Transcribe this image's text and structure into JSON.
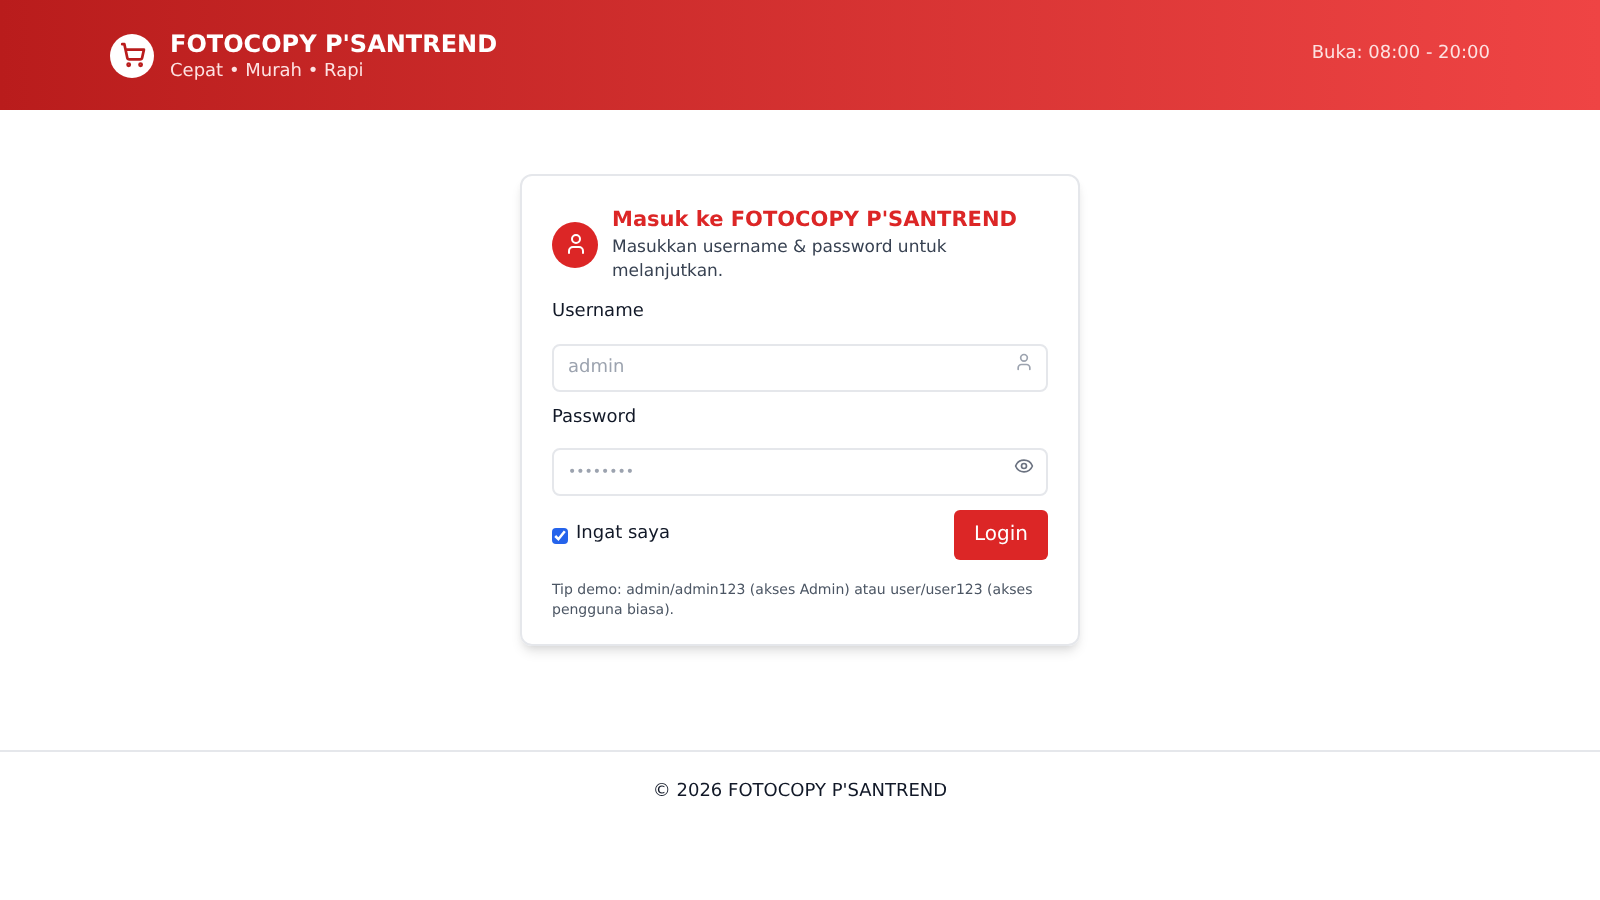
{
  "header": {
    "title": "FOTOCOPY P'SANTREND",
    "tagline": "Cepat • Murah • Rapi",
    "hours": "Buka: 08:00 - 20:00"
  },
  "login": {
    "title": "Masuk ke FOTOCOPY P'SANTREND",
    "subtitle": "Masukkan username & password untuk melanjutkan.",
    "username": {
      "label": "Username",
      "placeholder": "admin"
    },
    "password": {
      "label": "Password",
      "placeholder": "••••••••"
    },
    "remember": {
      "label": "Ingat saya",
      "checked": true
    },
    "button": "Login",
    "tip": "Tip demo: admin/admin123 (akses Admin) atau user/user123 (akses pengguna biasa)."
  },
  "footer": "© 2026 FOTOCOPY P'SANTREND"
}
